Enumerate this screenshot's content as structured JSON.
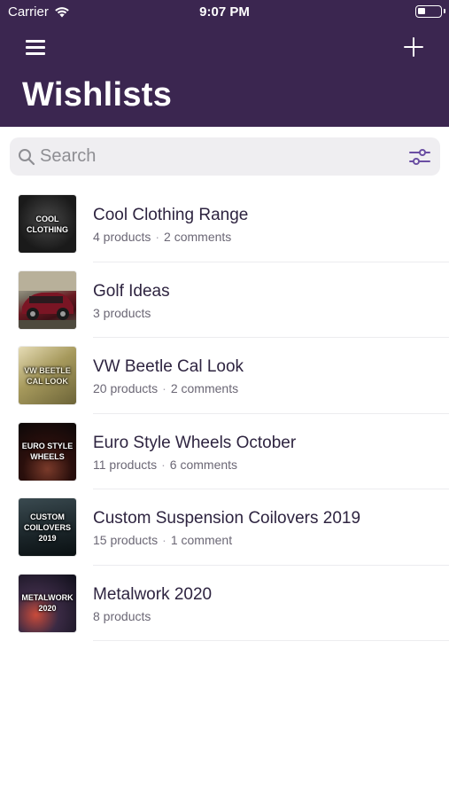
{
  "status_bar": {
    "carrier": "Carrier",
    "time": "9:07 PM",
    "battery_level": 0.35
  },
  "header": {
    "title": "Wishlists",
    "background_color": "#3b2650",
    "menu_icon": "hamburger-menu-icon",
    "add_icon": "plus-icon"
  },
  "search": {
    "placeholder": "Search",
    "value": "",
    "filter_icon": "sliders-filter-icon",
    "accent_color": "#6b4fa3"
  },
  "wishlists": [
    {
      "name": "Cool Clothing Range",
      "products": "4 products",
      "comments": "2 comments",
      "thumb_text": "Cool Clothing"
    },
    {
      "name": "Golf Ideas",
      "products": "3 products",
      "comments": "",
      "thumb_text": ""
    },
    {
      "name": "VW Beetle Cal Look",
      "products": "20 products",
      "comments": "2 comments",
      "thumb_text": "VW Beetle Cal Look"
    },
    {
      "name": "Euro Style Wheels October",
      "products": "11 products",
      "comments": "6 comments",
      "thumb_text": "Euro Style Wheels"
    },
    {
      "name": "Custom Suspension Coilovers 2019",
      "products": "15 products",
      "comments": "1 comment",
      "thumb_text": "Custom Coilovers 2019"
    },
    {
      "name": "Metalwork 2020",
      "products": "8 products",
      "comments": "",
      "thumb_text": "Metalwork 2020"
    }
  ]
}
